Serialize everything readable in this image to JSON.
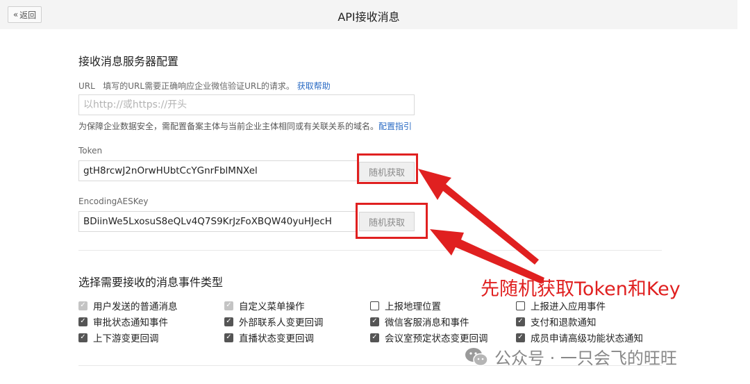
{
  "header": {
    "back_icon": "«",
    "back_label": "返回",
    "title": "API接收消息"
  },
  "server_config": {
    "title": "接收消息服务器配置",
    "url": {
      "label": "URL",
      "desc": "填写的URL需要正确响应企业微信验证URL的请求。",
      "help_link": "获取帮助",
      "placeholder": "以http://或https://开头",
      "value": ""
    },
    "domain_hint": "为保障企业数据安全，需配置备案主体与当前企业主体相同或有关联关系的域名。",
    "domain_link": "配置指引",
    "token": {
      "label": "Token",
      "value": "gtH8rcwJ2nOrwHUbtCcYGnrFblMNXel",
      "button": "随机获取"
    },
    "aes": {
      "label": "EncodingAESKey",
      "value": "BDiinWe5LxosuS8eQLv4Q7S9KrJzFoXBQW40yuHJecH",
      "button": "随机获取"
    }
  },
  "events": {
    "title": "选择需要接收的消息事件类型",
    "items": [
      {
        "label": "用户发送的普通消息",
        "state": "disabled"
      },
      {
        "label": "自定义菜单操作",
        "state": "disabled"
      },
      {
        "label": "上报地理位置",
        "state": "unchecked"
      },
      {
        "label": "上报进入应用事件",
        "state": "unchecked"
      },
      {
        "label": "审批状态通知事件",
        "state": "checked"
      },
      {
        "label": "外部联系人变更回调",
        "state": "checked"
      },
      {
        "label": "微信客服消息和事件",
        "state": "checked"
      },
      {
        "label": "支付和退款通知",
        "state": "checked"
      },
      {
        "label": "上下游变更回调",
        "state": "checked"
      },
      {
        "label": "直播状态变更回调",
        "state": "checked"
      },
      {
        "label": "会议室预定状态变更回调",
        "state": "checked"
      },
      {
        "label": "成员申请高级功能状态通知",
        "state": "checked"
      }
    ]
  },
  "annotation": {
    "text": "先随机获取Token和Key",
    "color": "#e02020"
  },
  "watermark": {
    "icon": "wechat-icon",
    "text": "公众号 · 一只会飞的旺旺"
  },
  "colors": {
    "link": "#2a6bc4",
    "highlight": "#e02020",
    "topbar": "#f4f4f4"
  }
}
